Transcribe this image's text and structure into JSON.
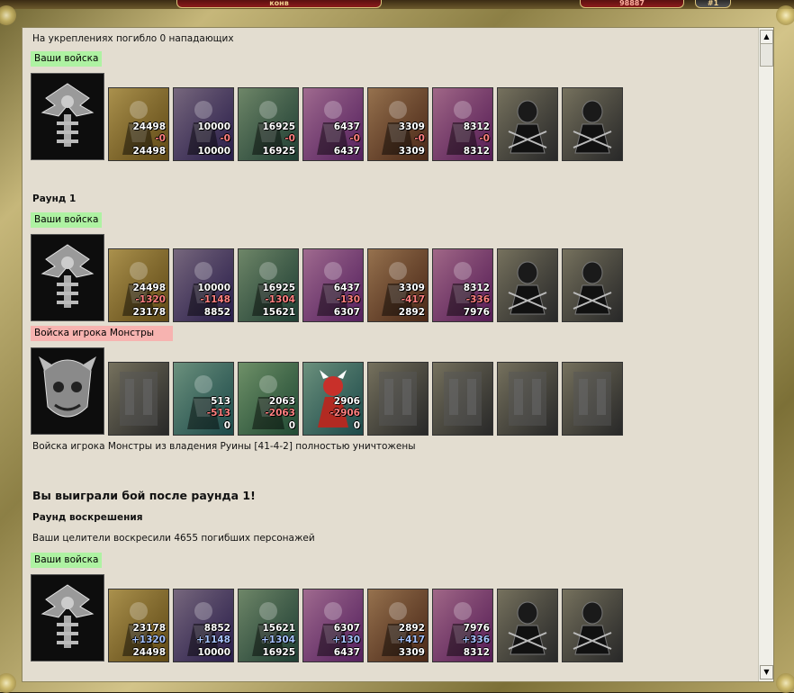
{
  "window": {
    "top_tab_left": "конв",
    "top_tab_right": "98887",
    "top_right_badge": "#1"
  },
  "fort_text": "На укреплениях погибло 0 нападающих",
  "sections": [
    {
      "label": "Ваши войска",
      "label_color": "#aef2a2",
      "hero_icon": "skull-bat-emblem-icon",
      "units": [
        {
          "icon": "troll-icon",
          "top": "24498",
          "mid": "-0",
          "bot": "24498",
          "mid_type": "neg"
        },
        {
          "icon": "dark-knight-icon",
          "top": "10000",
          "mid": "-0",
          "bot": "10000",
          "mid_type": "neg"
        },
        {
          "icon": "lizard-warrior-icon",
          "top": "16925",
          "mid": "-0",
          "bot": "16925",
          "mid_type": "neg"
        },
        {
          "icon": "purple-griffin-icon",
          "top": "6437",
          "mid": "-0",
          "bot": "6437",
          "mid_type": "neg"
        },
        {
          "icon": "archer-icon",
          "top": "3309",
          "mid": "-0",
          "bot": "3309",
          "mid_type": "neg"
        },
        {
          "icon": "sorceress-icon",
          "top": "8312",
          "mid": "-0",
          "bot": "8312",
          "mid_type": "neg"
        },
        {
          "icon": "assassin-icon",
          "top": "",
          "mid": "",
          "bot": "",
          "mid_type": "none"
        },
        {
          "icon": "spider-rider-icon",
          "top": "",
          "mid": "",
          "bot": "",
          "mid_type": "none"
        }
      ]
    },
    {
      "round_title": "Раунд 1",
      "label": "Ваши войска",
      "hero_icon": "skull-bat-emblem-icon",
      "units": [
        {
          "icon": "troll-icon",
          "top": "24498",
          "mid": "-1320",
          "bot": "23178",
          "mid_type": "neg"
        },
        {
          "icon": "dark-knight-icon",
          "top": "10000",
          "mid": "-1148",
          "bot": "8852",
          "mid_type": "neg"
        },
        {
          "icon": "lizard-warrior-icon",
          "top": "16925",
          "mid": "-1304",
          "bot": "15621",
          "mid_type": "neg"
        },
        {
          "icon": "purple-griffin-icon",
          "top": "6437",
          "mid": "-130",
          "bot": "6307",
          "mid_type": "neg"
        },
        {
          "icon": "archer-icon",
          "top": "3309",
          "mid": "-417",
          "bot": "2892",
          "mid_type": "neg"
        },
        {
          "icon": "sorceress-icon",
          "top": "8312",
          "mid": "-336",
          "bot": "7976",
          "mid_type": "neg"
        },
        {
          "icon": "assassin-icon",
          "top": "",
          "mid": "",
          "bot": "",
          "mid_type": "none"
        },
        {
          "icon": "spider-rider-icon",
          "top": "",
          "mid": "",
          "bot": "",
          "mid_type": "none"
        }
      ]
    },
    {
      "label": "Войска игрока Монстры",
      "hero_icon": "demon-face-emblem-icon",
      "units": [
        {
          "icon": "empty-slot-icon",
          "top": "",
          "mid": "",
          "bot": "",
          "mid_type": "none"
        },
        {
          "icon": "armored-orc-icon",
          "top": "513",
          "mid": "-513",
          "bot": "0",
          "mid_type": "neg"
        },
        {
          "icon": "orc-warlord-icon",
          "top": "2063",
          "mid": "-2063",
          "bot": "0",
          "mid_type": "neg"
        },
        {
          "icon": "red-demon-icon",
          "top": "2906",
          "mid": "-2906",
          "bot": "0",
          "mid_type": "neg"
        },
        {
          "icon": "empty-slot-icon",
          "top": "",
          "mid": "",
          "bot": "",
          "mid_type": "none"
        },
        {
          "icon": "empty-slot-icon",
          "top": "",
          "mid": "",
          "bot": "",
          "mid_type": "none"
        },
        {
          "icon": "empty-slot-icon",
          "top": "",
          "mid": "",
          "bot": "",
          "mid_type": "none"
        },
        {
          "icon": "empty-slot-icon",
          "top": "",
          "mid": "",
          "bot": "",
          "mid_type": "none"
        }
      ]
    },
    {
      "label": "Ваши войска",
      "hero_icon": "skull-bat-emblem-icon",
      "units": [
        {
          "icon": "troll-icon",
          "top": "23178",
          "mid": "+1320",
          "bot": "24498",
          "mid_type": "pos"
        },
        {
          "icon": "dark-knight-icon",
          "top": "8852",
          "mid": "+1148",
          "bot": "10000",
          "mid_type": "pos"
        },
        {
          "icon": "lizard-warrior-icon",
          "top": "15621",
          "mid": "+1304",
          "bot": "16925",
          "mid_type": "pos"
        },
        {
          "icon": "purple-griffin-icon",
          "top": "6307",
          "mid": "+130",
          "bot": "6437",
          "mid_type": "pos"
        },
        {
          "icon": "archer-icon",
          "top": "2892",
          "mid": "+417",
          "bot": "3309",
          "mid_type": "pos"
        },
        {
          "icon": "sorceress-icon",
          "top": "7976",
          "mid": "+336",
          "bot": "8312",
          "mid_type": "pos"
        },
        {
          "icon": "assassin-icon",
          "top": "",
          "mid": "",
          "bot": "",
          "mid_type": "none"
        },
        {
          "icon": "spider-rider-icon",
          "top": "",
          "mid": "",
          "bot": "",
          "mid_type": "none"
        }
      ]
    }
  ],
  "destroyed_text": "Войска игрока Монстры из владения Руины [41-4-2] полностью уничтожены",
  "victory_text": "Вы выиграли бой после раунда 1!",
  "resurrection_title": "Раунд воскрешения",
  "resurrection_text": "Ваши целители воскресили 4655 погибших персонажей",
  "unit_colors": {
    "troll": "#8a6a20",
    "knight": "#3b2a6a",
    "lizard": "#2e5a4a",
    "griffin": "#7a2f86",
    "archer": "#6b3a22",
    "sorceress": "#7b2a7a",
    "gray": "#3a3a3a",
    "orc": "#2f6a4a",
    "demon": "#2a6a6a"
  }
}
